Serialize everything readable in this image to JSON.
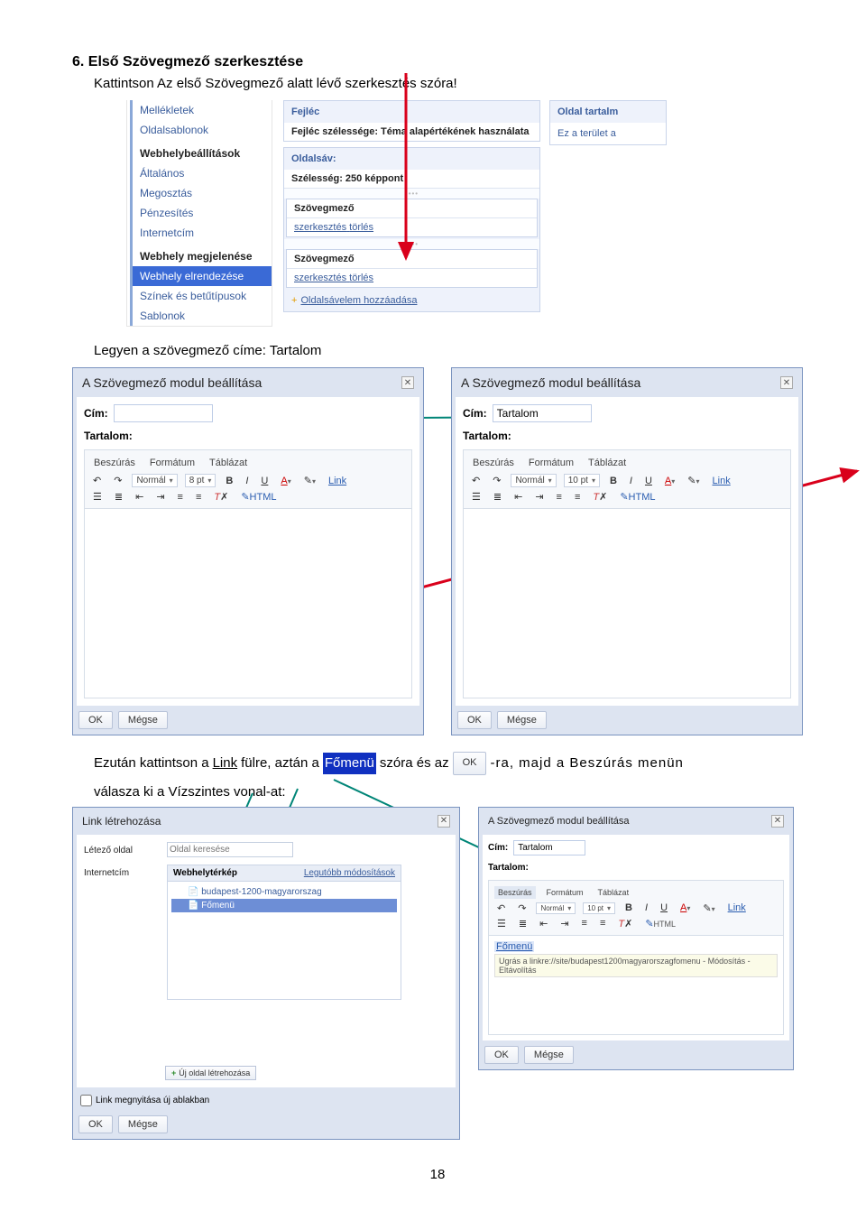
{
  "heading": "6. Első Szövegmező szerkesztése",
  "sub": "Kattintson Az első Szövegmező alatt lévő szerkesztés szóra!",
  "menu": {
    "items0": [
      "Mellékletek",
      "Oldalsablonok"
    ],
    "group1_title": "Webhelybeállítások",
    "group1": [
      "Általános",
      "Megosztás",
      "Pénzesítés",
      "Internetcím"
    ],
    "group2_title": "Webhely megjelenése",
    "selected": "Webhely elrendezése",
    "group2_rest": [
      "Színek és betűtípusok",
      "Sablonok"
    ]
  },
  "center": {
    "header_title": "Fejléc",
    "header_width": "Fejléc szélessége: Téma alapértékének használata",
    "sidebar_title": "Oldalsáv:",
    "sidebar_width": "Szélesség: 250 képpont",
    "textbox": "Szövegmező",
    "edit_link": "szerkesztés",
    "delete_link": "törlés",
    "add_item": "Oldalsávelem hozzáadása"
  },
  "side": {
    "title": "Oldal tartalm",
    "text": "Ez a terület a"
  },
  "body2": "Legyen a szövegmező címe: Tartalom",
  "dialog": {
    "title": "A Szövegmező modul beállítása",
    "cim_label": "Cím:",
    "cim_val_left": "",
    "cim_val_right": "Tartalom",
    "content_label": "Tartalom:",
    "tabs": [
      "Beszúrás",
      "Formátum",
      "Táblázat"
    ],
    "format_sel": "Normál",
    "size_left": "8 pt",
    "size_right": "10 pt",
    "link_btn": "Link",
    "html_btn": "HTML",
    "ok": "OK",
    "cancel": "Mégse"
  },
  "flow": {
    "p1a": "Ezután kattintson a",
    "link_word": "Link",
    "p1b": "fülre, aztán a",
    "fomenu": "Főmenü",
    "p1c": "szóra és az",
    "ok_btn": "OK",
    "p1d": "-ra,  majd  a  Beszúrás  menün",
    "p2": "válasza ki a Vízszintes vonal-at:"
  },
  "linkDialog": {
    "title": "Link létrehozása",
    "existing": "Létező oldal",
    "search_ph": "Oldal keresése",
    "url_lbl": "Internetcím",
    "tree_title": "Webhelytérkép",
    "tree_link": "Legutóbb módosítások",
    "tree_items": [
      "budapest-1200-magyarorszag",
      "Főmenü"
    ],
    "add_page": "Új oldal létrehozása",
    "chk": "Link megnyitása új ablakban",
    "ok": "OK",
    "cancel": "Mégse"
  },
  "bottomDialog": {
    "title": "A Szövegmező modul beállítása",
    "cim": "Cím:",
    "cim_val": "Tartalom",
    "content": "Tartalom:",
    "tabs": [
      "Beszúrás",
      "Formátum",
      "Táblázat"
    ],
    "link_txt": "Főmenü",
    "hint": "Ugrás a linkre://site/budapest1200magyarorszagfomenu - Módosítás - Eltávolítás",
    "ok": "OK",
    "cancel": "Mégse"
  },
  "page_num": "18"
}
